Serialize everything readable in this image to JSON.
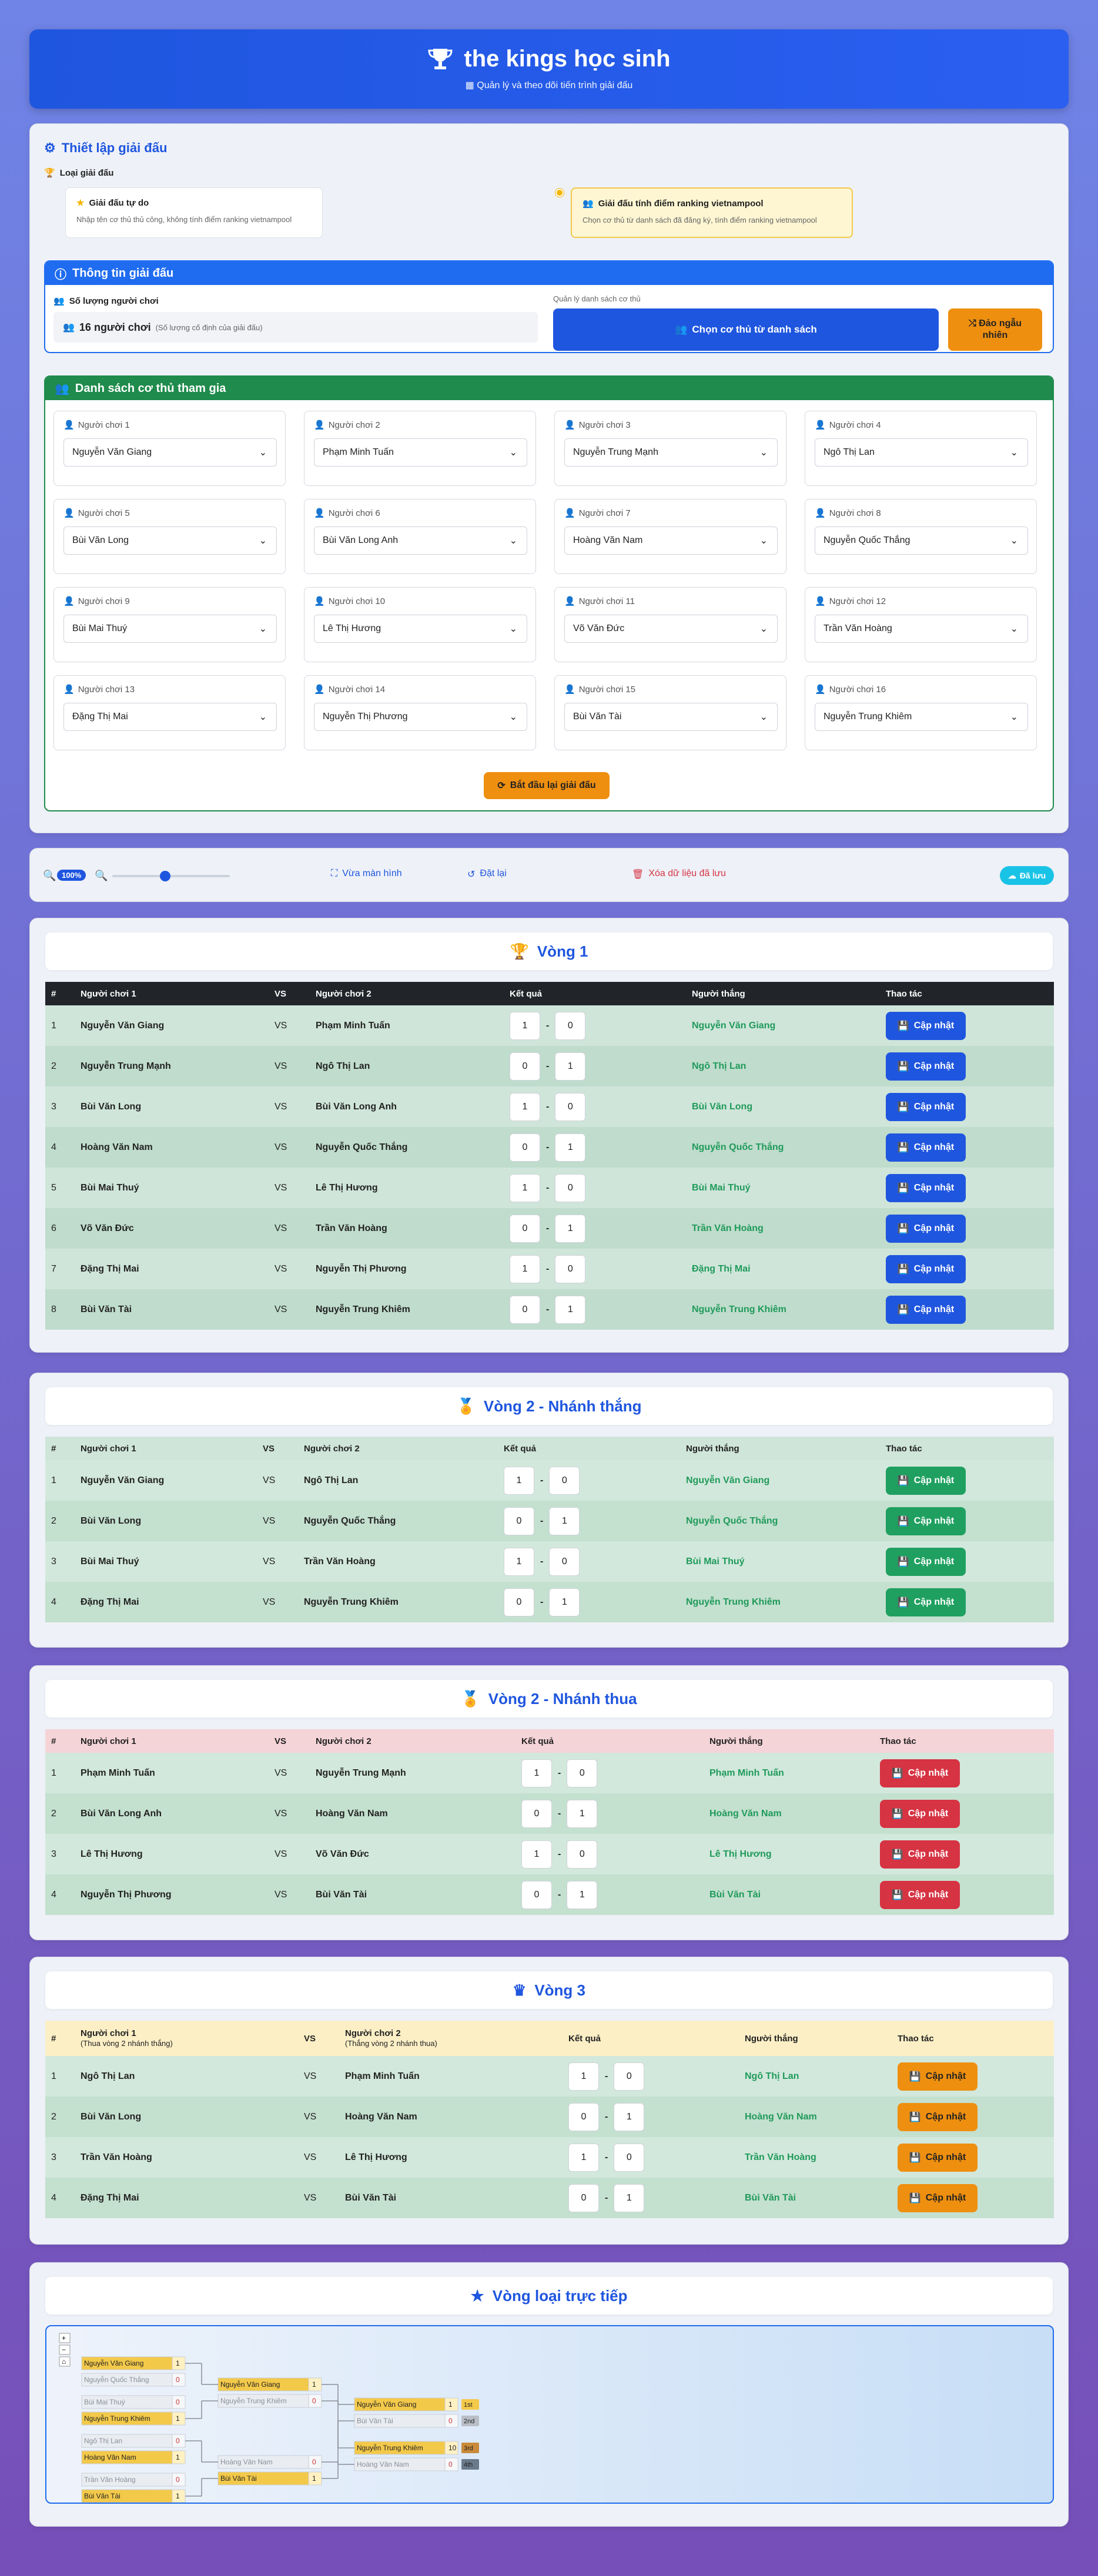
{
  "header": {
    "title": "the kings học sinh",
    "subtitle": "Quản lý và theo dõi tiến trình giải đấu"
  },
  "setup": {
    "title": "Thiết lập giải đấu",
    "type_label": "Loại giải đấu",
    "type_free": {
      "title": "Giải đấu tự do",
      "desc": "Nhập tên cơ thủ thủ công, không tính điểm ranking vietnampool"
    },
    "type_ranking": {
      "title": "Giải đấu tính điểm ranking vietnampool",
      "desc": "Chọn cơ thủ từ danh sách đã đăng ký, tính điểm ranking vietnampool"
    },
    "info_title": "Thông tin giải đấu",
    "count_label": "Số lượng người chơi",
    "count_value": "16 người chơi",
    "count_note": "(Số lượng cố định của giải đấu)",
    "manage_label": "Quản lý danh sách cơ thủ",
    "choose_btn": "Chọn cơ thủ từ danh sách",
    "shuffle_btn_1": "Đảo ngẫu",
    "shuffle_btn_2": "nhiên",
    "players_title": "Danh sách cơ thủ tham gia",
    "players": [
      {
        "label": "Người chơi 1",
        "name": "Nguyễn Văn Giang"
      },
      {
        "label": "Người chơi 2",
        "name": "Phạm Minh Tuấn"
      },
      {
        "label": "Người chơi 3",
        "name": "Nguyễn Trung Mạnh"
      },
      {
        "label": "Người chơi 4",
        "name": "Ngô Thị Lan"
      },
      {
        "label": "Người chơi 5",
        "name": "Bùi Văn Long"
      },
      {
        "label": "Người chơi 6",
        "name": "Bùi Văn Long Anh"
      },
      {
        "label": "Người chơi 7",
        "name": "Hoàng Văn Nam"
      },
      {
        "label": "Người chơi 8",
        "name": "Nguyễn Quốc Thắng"
      },
      {
        "label": "Người chơi 9",
        "name": "Bùi Mai Thuý"
      },
      {
        "label": "Người chơi 10",
        "name": "Lê Thị Hương"
      },
      {
        "label": "Người chơi 11",
        "name": "Võ Văn Đức"
      },
      {
        "label": "Người chơi 12",
        "name": "Trần Văn Hoàng"
      },
      {
        "label": "Người chơi 13",
        "name": "Đặng Thị Mai"
      },
      {
        "label": "Người chơi 14",
        "name": "Nguyễn Thị Phương"
      },
      {
        "label": "Người chơi 15",
        "name": "Bùi Văn Tài"
      },
      {
        "label": "Người chơi 16",
        "name": "Nguyễn Trung Khiêm"
      }
    ],
    "restart_btn": "Bắt đầu lại giải đấu"
  },
  "controls": {
    "zoom": "100%",
    "fit_btn": "Vừa màn hình",
    "reset_btn": "Đặt lại",
    "clear_btn": "Xóa dữ liệu đã lưu",
    "saved_badge": "Đã lưu",
    "zoom_level": 0.45
  },
  "headers": {
    "num": "#",
    "p1": "Người chơi 1",
    "vs": "VS",
    "p2": "Người chơi 2",
    "result": "Kết quả",
    "winner": "Người thắng",
    "action": "Thao tác",
    "update": "Cập nhật",
    "dash": "-"
  },
  "round1": {
    "title": "Vòng 1",
    "rows": [
      {
        "n": "1",
        "p1": "Nguyễn Văn Giang",
        "p2": "Phạm Minh Tuấn",
        "s1": "1",
        "s2": "0",
        "w": "Nguyễn Văn Giang"
      },
      {
        "n": "2",
        "p1": "Nguyễn Trung Mạnh",
        "p2": "Ngô Thị Lan",
        "s1": "0",
        "s2": "1",
        "w": "Ngô Thị Lan"
      },
      {
        "n": "3",
        "p1": "Bùi Văn Long",
        "p2": "Bùi Văn Long Anh",
        "s1": "1",
        "s2": "0",
        "w": "Bùi Văn Long"
      },
      {
        "n": "4",
        "p1": "Hoàng Văn Nam",
        "p2": "Nguyễn Quốc Thắng",
        "s1": "0",
        "s2": "1",
        "w": "Nguyễn Quốc Thắng"
      },
      {
        "n": "5",
        "p1": "Bùi Mai Thuý",
        "p2": "Lê Thị Hương",
        "s1": "1",
        "s2": "0",
        "w": "Bùi Mai Thuý"
      },
      {
        "n": "6",
        "p1": "Võ Văn Đức",
        "p2": "Trần Văn Hoàng",
        "s1": "0",
        "s2": "1",
        "w": "Trần Văn Hoàng"
      },
      {
        "n": "7",
        "p1": "Đặng Thị Mai",
        "p2": "Nguyễn Thị Phương",
        "s1": "1",
        "s2": "0",
        "w": "Đặng Thị Mai"
      },
      {
        "n": "8",
        "p1": "Bùi Văn Tài",
        "p2": "Nguyễn Trung Khiêm",
        "s1": "0",
        "s2": "1",
        "w": "Nguyễn Trung Khiêm"
      }
    ]
  },
  "round2w": {
    "title": "Vòng 2 - Nhánh thắng",
    "rows": [
      {
        "n": "1",
        "p1": "Nguyễn Văn Giang",
        "p2": "Ngô Thị Lan",
        "s1": "1",
        "s2": "0",
        "w": "Nguyễn Văn Giang"
      },
      {
        "n": "2",
        "p1": "Bùi Văn Long",
        "p2": "Nguyễn Quốc Thắng",
        "s1": "0",
        "s2": "1",
        "w": "Nguyễn Quốc Thắng"
      },
      {
        "n": "3",
        "p1": "Bùi Mai Thuý",
        "p2": "Trần Văn Hoàng",
        "s1": "1",
        "s2": "0",
        "w": "Bùi Mai Thuý"
      },
      {
        "n": "4",
        "p1": "Đặng Thị Mai",
        "p2": "Nguyễn Trung Khiêm",
        "s1": "0",
        "s2": "1",
        "w": "Nguyễn Trung Khiêm"
      }
    ]
  },
  "round2l": {
    "title": "Vòng 2 - Nhánh thua",
    "rows": [
      {
        "n": "1",
        "p1": "Phạm Minh Tuấn",
        "p2": "Nguyễn Trung Mạnh",
        "s1": "1",
        "s2": "0",
        "w": "Phạm Minh Tuấn"
      },
      {
        "n": "2",
        "p1": "Bùi Văn Long Anh",
        "p2": "Hoàng Văn Nam",
        "s1": "0",
        "s2": "1",
        "w": "Hoàng Văn Nam"
      },
      {
        "n": "3",
        "p1": "Lê Thị Hương",
        "p2": "Võ Văn Đức",
        "s1": "1",
        "s2": "0",
        "w": "Lê Thị Hương"
      },
      {
        "n": "4",
        "p1": "Nguyễn Thị Phương",
        "p2": "Bùi Văn Tài",
        "s1": "0",
        "s2": "1",
        "w": "Bùi Văn Tài"
      }
    ]
  },
  "round3": {
    "title": "Vòng 3",
    "p1_note": "(Thua vòng 2 nhánh thắng)",
    "p2_note": "(Thắng vòng 2 nhánh thua)",
    "rows": [
      {
        "n": "1",
        "p1": "Ngô Thị Lan",
        "p2": "Phạm Minh Tuấn",
        "s1": "1",
        "s2": "0",
        "w": "Ngô Thị Lan"
      },
      {
        "n": "2",
        "p1": "Bùi Văn Long",
        "p2": "Hoàng Văn Nam",
        "s1": "0",
        "s2": "1",
        "w": "Hoàng Văn Nam"
      },
      {
        "n": "3",
        "p1": "Trần Văn Hoàng",
        "p2": "Lê Thị Hương",
        "s1": "1",
        "s2": "0",
        "w": "Trần Văn Hoàng"
      },
      {
        "n": "4",
        "p1": "Đặng Thị Mai",
        "p2": "Bùi Văn Tài",
        "s1": "0",
        "s2": "1",
        "w": "Bùi Văn Tài"
      }
    ]
  },
  "bracket": {
    "title": "Vòng loại trực tiếp",
    "c1": [
      [
        "Nguyễn Văn Giang",
        "1"
      ],
      [
        "Nguyễn Quốc Thắng",
        "0"
      ],
      [
        "Bùi Mai Thuý",
        "0"
      ],
      [
        "Nguyễn Trung Khiêm",
        "1"
      ],
      [
        "Ngô Thị Lan",
        "0"
      ],
      [
        "Hoàng Văn Nam",
        "1"
      ],
      [
        "Trần Văn Hoàng",
        "0"
      ],
      [
        "Bùi Văn Tài",
        "1"
      ]
    ],
    "c2": [
      [
        "Nguyễn Văn Giang",
        "1"
      ],
      [
        "Nguyễn Trung Khiêm",
        "0"
      ],
      [
        "Hoàng Văn Nam",
        "0"
      ],
      [
        "Bùi Văn Tài",
        "1"
      ]
    ],
    "c3": [
      [
        "Nguyễn Văn Giang",
        "1"
      ],
      [
        "Bùi Văn Tài",
        "0"
      ],
      [
        "Nguyễn Trung Khiêm",
        "10"
      ],
      [
        "Hoàng Văn Nam",
        "0"
      ]
    ],
    "badges": [
      "1st",
      "2nd",
      "3rd",
      "4th"
    ]
  }
}
